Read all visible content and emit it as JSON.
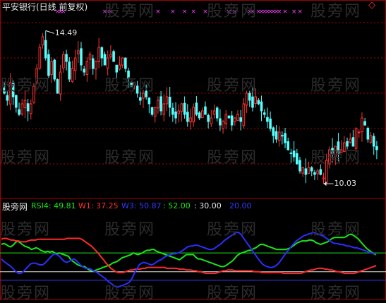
{
  "stock_title": "平安银行(日线 前复权)",
  "watermark": "股旁网",
  "price_panel": {
    "high_label": "14.49",
    "low_label": "10.03",
    "marker_symbol": "×",
    "up_color": "#ff3333",
    "down_color": "#54ffff",
    "grid_color": "#b00000"
  },
  "indicator_panel": {
    "name": "股旁网",
    "legend": [
      {
        "key": "RSI4",
        "text": "RSI4: 49.81",
        "color": "#19e619"
      },
      {
        "key": "W1",
        "text": "W1: 37.25",
        "color": "#ff3030"
      },
      {
        "key": "W3",
        "text": "W3: 50.87",
        "color": "#3838ff"
      },
      {
        "key": "L52",
        "text": ": 52.00",
        "color": "#19e619"
      },
      {
        "key": "L30",
        "text": ": 30.00",
        "color": "#e6e6e6"
      },
      {
        "key": "L20",
        "text": "20.00",
        "color": "#3838ff"
      }
    ]
  },
  "chart_data": [
    {
      "type": "candlestick",
      "title": "平安银行(日线 前复权)",
      "annotations": [
        {
          "label": "14.49",
          "kind": "period-high"
        },
        {
          "label": "10.03",
          "kind": "period-low"
        }
      ],
      "ylim": [
        9.8,
        14.8
      ],
      "close": [
        12.6,
        12.4,
        12.9,
        12.5,
        12.2,
        12.0,
        12.3,
        12.4,
        12.1,
        12.3,
        12.8,
        13.3,
        13.9,
        14.2,
        13.6,
        13.1,
        13.5,
        13.0,
        12.6,
        13.2,
        13.7,
        13.5,
        13.0,
        13.3,
        13.6,
        13.8,
        13.4,
        13.2,
        13.5,
        13.7,
        13.3,
        13.5,
        13.9,
        13.6,
        13.4,
        13.6,
        13.7,
        13.5,
        13.2,
        13.4,
        13.6,
        13.3,
        13.0,
        12.8,
        12.9,
        12.6,
        12.4,
        12.6,
        12.5,
        12.3,
        12.0,
        12.2,
        12.4,
        12.1,
        12.3,
        12.5,
        12.2,
        12.0,
        11.9,
        12.1,
        12.3,
        12.0,
        11.8,
        11.9,
        12.2,
        12.0,
        11.9,
        12.1,
        12.0,
        11.8,
        11.9,
        12.1,
        11.9,
        11.7,
        11.8,
        12.0,
        11.9,
        11.7,
        11.9,
        12.0,
        11.8,
        12.3,
        12.6,
        12.4,
        12.2,
        12.5,
        12.3,
        12.1,
        12.0,
        11.8,
        11.6,
        11.4,
        11.3,
        11.5,
        11.4,
        11.2,
        11.0,
        10.9,
        10.8,
        10.6,
        10.4,
        10.5,
        10.3,
        10.5,
        10.4,
        10.3,
        10.4,
        10.3,
        10.2,
        10.7,
        11.0,
        10.9,
        11.1,
        10.9,
        11.0,
        11.2,
        11.1,
        11.3,
        11.1,
        11.6,
        11.5,
        11.9,
        11.7,
        11.3,
        11.4,
        11.1,
        11.0
      ]
    },
    {
      "type": "line",
      "ylim": [
        0,
        100
      ],
      "reference_lines": [
        52,
        30,
        20
      ],
      "series": [
        {
          "name": "RSI4",
          "values": [
            62,
            63,
            62,
            60,
            59,
            61,
            64,
            66,
            64,
            62,
            60,
            59,
            58,
            56,
            57,
            58,
            57,
            55,
            54,
            53,
            54,
            53,
            54,
            52,
            51,
            52,
            51,
            50,
            49,
            48,
            44,
            42,
            40,
            38,
            37,
            36,
            36,
            34,
            32,
            31,
            31,
            32,
            33,
            34,
            35,
            36,
            37,
            38,
            40,
            41,
            42,
            44,
            46,
            47,
            48,
            49,
            50,
            52,
            51,
            50,
            51,
            52,
            54,
            55,
            55,
            56,
            56,
            54,
            53,
            52,
            51,
            50,
            49,
            48,
            47,
            46,
            45,
            44,
            46,
            48,
            50,
            50,
            50,
            50,
            47,
            45,
            45,
            44,
            43,
            42,
            41,
            40,
            39,
            38,
            37,
            36,
            36,
            37,
            39,
            41,
            43,
            46,
            49,
            51,
            52,
            53,
            54,
            55,
            55,
            57,
            58,
            60,
            62,
            62,
            61,
            60,
            59,
            58,
            57,
            56,
            56,
            56,
            56,
            56,
            57,
            58,
            60,
            62,
            64,
            65,
            66,
            66,
            66,
            67,
            67,
            66,
            64,
            63,
            62,
            63,
            64,
            65,
            67,
            69,
            70,
            70,
            70,
            70,
            70,
            71,
            73,
            74,
            73,
            71,
            69,
            66,
            63,
            60,
            57,
            55,
            53,
            51,
            49.81
          ]
        },
        {
          "name": "W1",
          "values": [
            68,
            69,
            69,
            68,
            67,
            67,
            66,
            66,
            65,
            65,
            65,
            66,
            67,
            67,
            67,
            68,
            68,
            68,
            68,
            68,
            68,
            68,
            68,
            68,
            68,
            68,
            68,
            69,
            69,
            69,
            69,
            69,
            69,
            68,
            66,
            64,
            62,
            60,
            57,
            54,
            51,
            47,
            44,
            40,
            37,
            34,
            32,
            30,
            29,
            29,
            29,
            30,
            31,
            32,
            32,
            33,
            33,
            33,
            34,
            34,
            35,
            35,
            35,
            35,
            35,
            35,
            35,
            35,
            34,
            34,
            34,
            34,
            34,
            33,
            33,
            33,
            32,
            32,
            32,
            31,
            31,
            30,
            30,
            29,
            28,
            28,
            28,
            28,
            28,
            29,
            30,
            31,
            31,
            32,
            32,
            32,
            31,
            31,
            31,
            31,
            31,
            31,
            31,
            31,
            30,
            30,
            30,
            29,
            29,
            29,
            29,
            29,
            29,
            29,
            29,
            29,
            28,
            28,
            28,
            28,
            28,
            28,
            28,
            28,
            29,
            30,
            31,
            32,
            32,
            33,
            34,
            34,
            34,
            33,
            33,
            32,
            32,
            31,
            30,
            30,
            29,
            28,
            28,
            28,
            28,
            28,
            29,
            30,
            31,
            32,
            33,
            34,
            35,
            36,
            37.25
          ]
        },
        {
          "name": "W3",
          "values": [
            45,
            42,
            40,
            38,
            36,
            33,
            30,
            28,
            28,
            30,
            33,
            36,
            39,
            40,
            40,
            39,
            38,
            38,
            40,
            43,
            46,
            49,
            51,
            50,
            48,
            45,
            42,
            41,
            42,
            44,
            45,
            43,
            40,
            37,
            35,
            34,
            34,
            33,
            31,
            30,
            28,
            26,
            24,
            22,
            19,
            17,
            15,
            13,
            12,
            13,
            14,
            15,
            16,
            18,
            22,
            28,
            33,
            38,
            40,
            41,
            40,
            39,
            38,
            39,
            41,
            43,
            44,
            46,
            48,
            49,
            50,
            51,
            51,
            52,
            53,
            55,
            57,
            59,
            60,
            60,
            61,
            61,
            60,
            59,
            58,
            57,
            56,
            56,
            57,
            59,
            61,
            63,
            66,
            68,
            70,
            72,
            74,
            76,
            76,
            74,
            70,
            66,
            62,
            58,
            54,
            50,
            46,
            42,
            39,
            37,
            36,
            35,
            35,
            36,
            38,
            41,
            45,
            49,
            53,
            56,
            60,
            63,
            66,
            68,
            70,
            72,
            73,
            74,
            75,
            76,
            75,
            74,
            73,
            72,
            70,
            68,
            66,
            64,
            63,
            63,
            62,
            62,
            61,
            60,
            60,
            59,
            58,
            58,
            57,
            56,
            55,
            54,
            53,
            52,
            51,
            50.87
          ]
        }
      ]
    }
  ]
}
